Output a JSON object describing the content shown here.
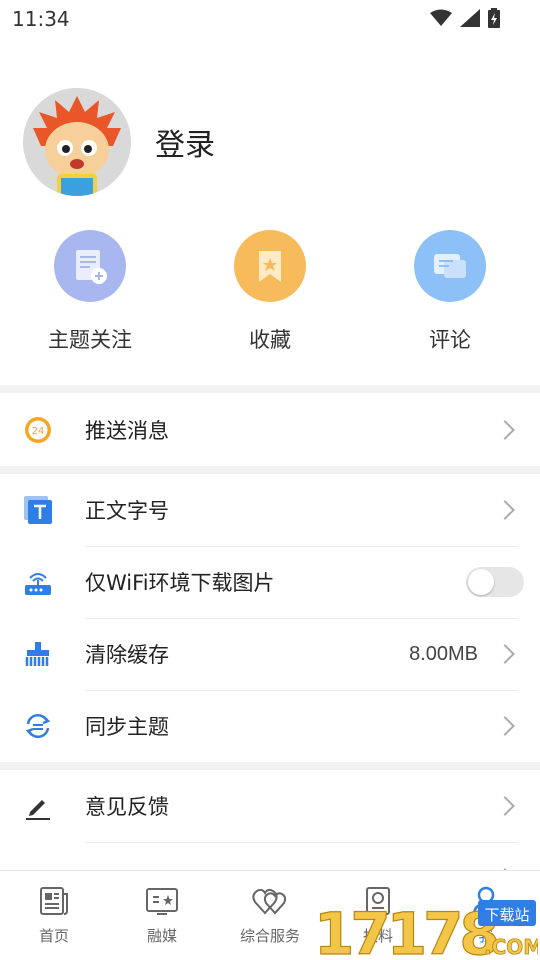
{
  "status_bar": {
    "time": "11:34"
  },
  "profile": {
    "login_label": "登录"
  },
  "quick_actions": [
    {
      "label": "主题关注",
      "icon": "subscribe-icon",
      "color": "#a9b7f0"
    },
    {
      "label": "收藏",
      "icon": "bookmark-icon",
      "color": "#f7bb5c"
    },
    {
      "label": "评论",
      "icon": "comment-icon",
      "color": "#8cc0f6"
    }
  ],
  "menu": {
    "push": {
      "label": "推送消息",
      "badge": "24"
    },
    "font_size": {
      "label": "正文字号"
    },
    "wifi_only": {
      "label": "仅WiFi环境下载图片",
      "enabled": false
    },
    "clear_cache": {
      "label": "清除缓存",
      "value": "8.00MB"
    },
    "sync": {
      "label": "同步主题"
    },
    "feedback": {
      "label": "意见反馈"
    }
  },
  "bottom_nav": [
    {
      "label": "首页",
      "icon": "home-news-icon",
      "active": false
    },
    {
      "label": "融媒",
      "icon": "media-icon",
      "active": false
    },
    {
      "label": "综合服务",
      "icon": "heart-service-icon",
      "active": false
    },
    {
      "label": "报料",
      "icon": "report-icon",
      "active": false
    },
    {
      "label": "我",
      "icon": "user-icon",
      "active": true
    }
  ],
  "watermark": {
    "text": "17178",
    "subtext": "下载站",
    "domain": ".COM"
  },
  "colors": {
    "accent": "#2f7ee6",
    "divider": "#ececec",
    "section_gap": "#f2f2f2"
  }
}
